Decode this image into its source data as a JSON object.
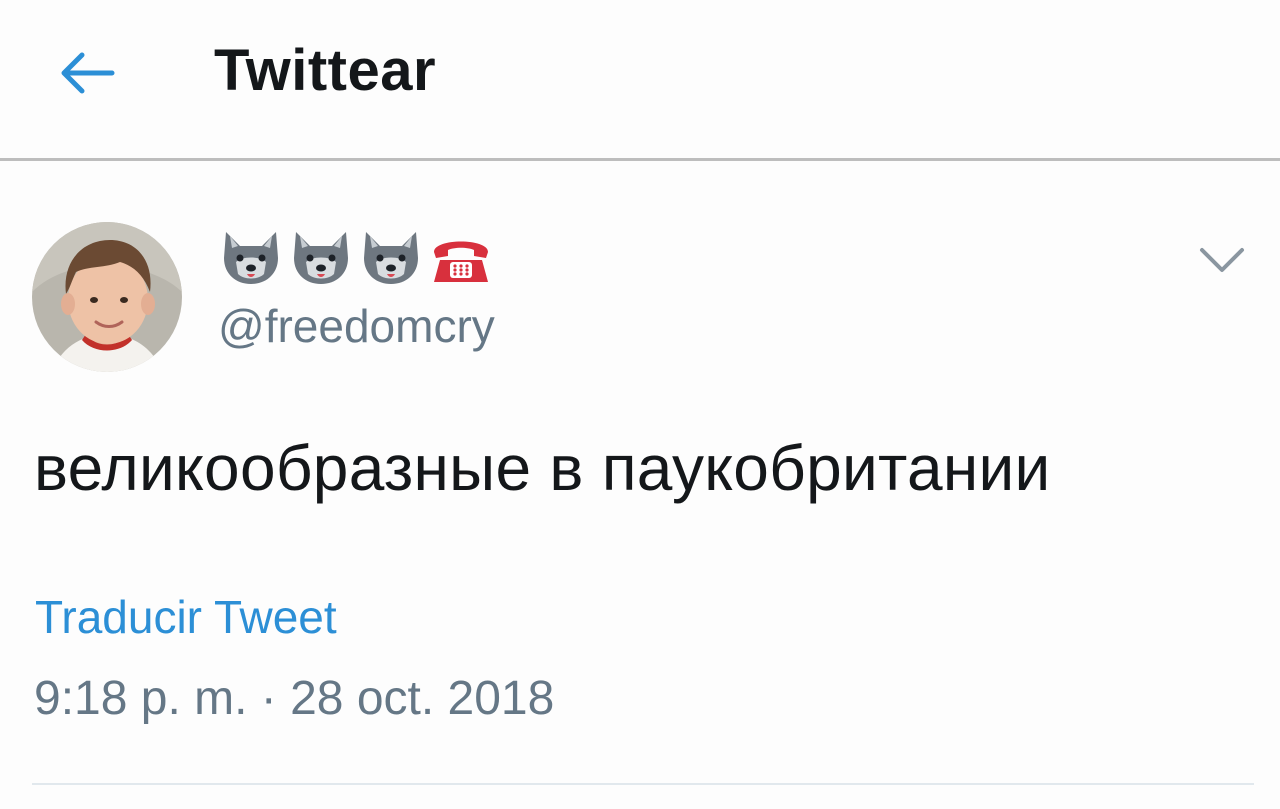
{
  "header": {
    "back_icon": "arrow-left-icon",
    "title": "Twittear",
    "accent_color": "#2c8fd6"
  },
  "tweet": {
    "avatar_icon": "user-avatar",
    "display_name_emojis": [
      "wolf-face-emoji",
      "wolf-face-emoji",
      "wolf-face-emoji",
      "telephone-emoji"
    ],
    "handle": "@freedomcry",
    "options_icon": "chevron-down-icon",
    "text": "великообразные в паукобритании",
    "translate_label": "Traducir Tweet",
    "timestamp": "9:18 p. m. · 28 oct. 2018"
  }
}
